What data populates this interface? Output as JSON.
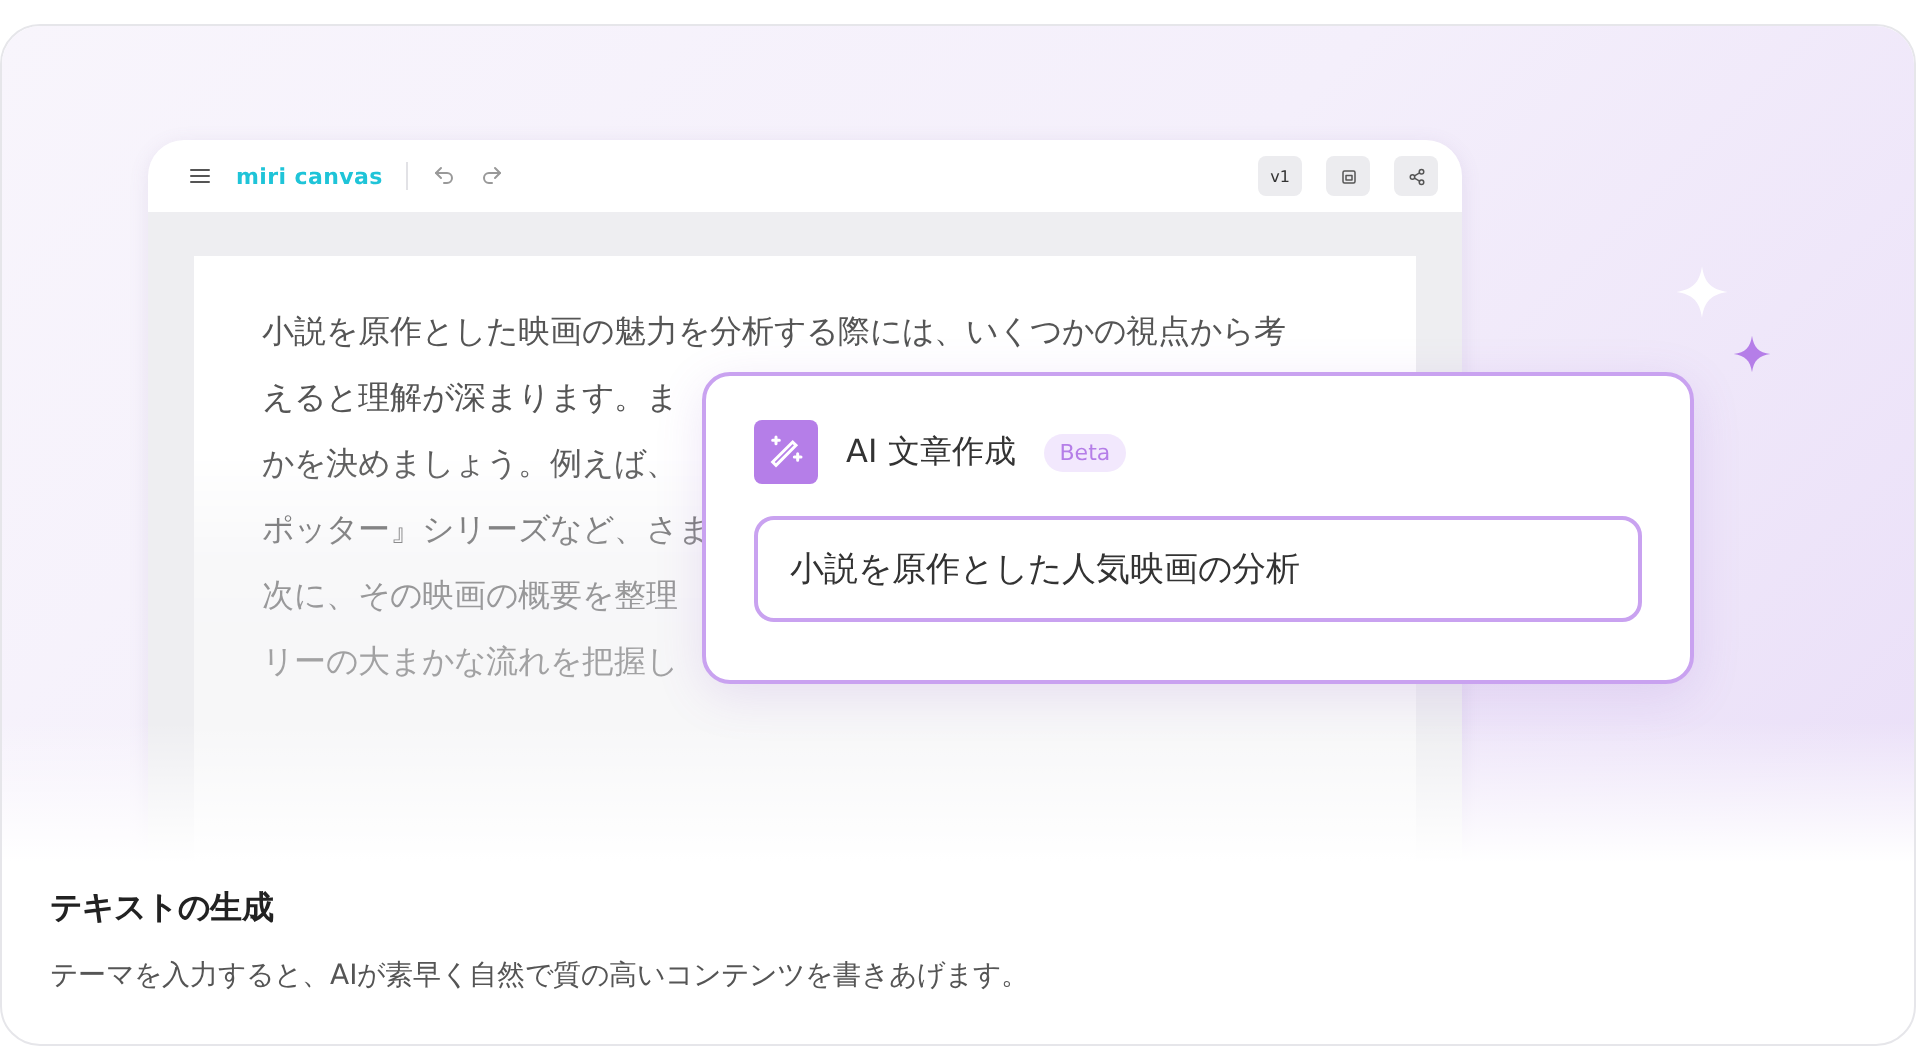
{
  "editor": {
    "logo": "miri canvas",
    "toolbar_buttons": [
      "v1"
    ],
    "lines": [
      "小説を原作とした映画の魅力を分析する際には、いくつかの視点から考",
      "えると理解が深まります。ま",
      "かを決めましょう。例えば、",
      "ポッター』シリーズなど、さま",
      "次に、その映画の概要を整理",
      "リーの大まかな流れを把握し"
    ]
  },
  "ai_popup": {
    "title": "AI 文章作成",
    "badge": "Beta",
    "input_value": "小説を原作とした人気映画の分析"
  },
  "caption": {
    "title": "テキストの生成",
    "description": "テーマを入力すると、AIが素早く自然で質の高いコンテンツを書きあげます。"
  }
}
